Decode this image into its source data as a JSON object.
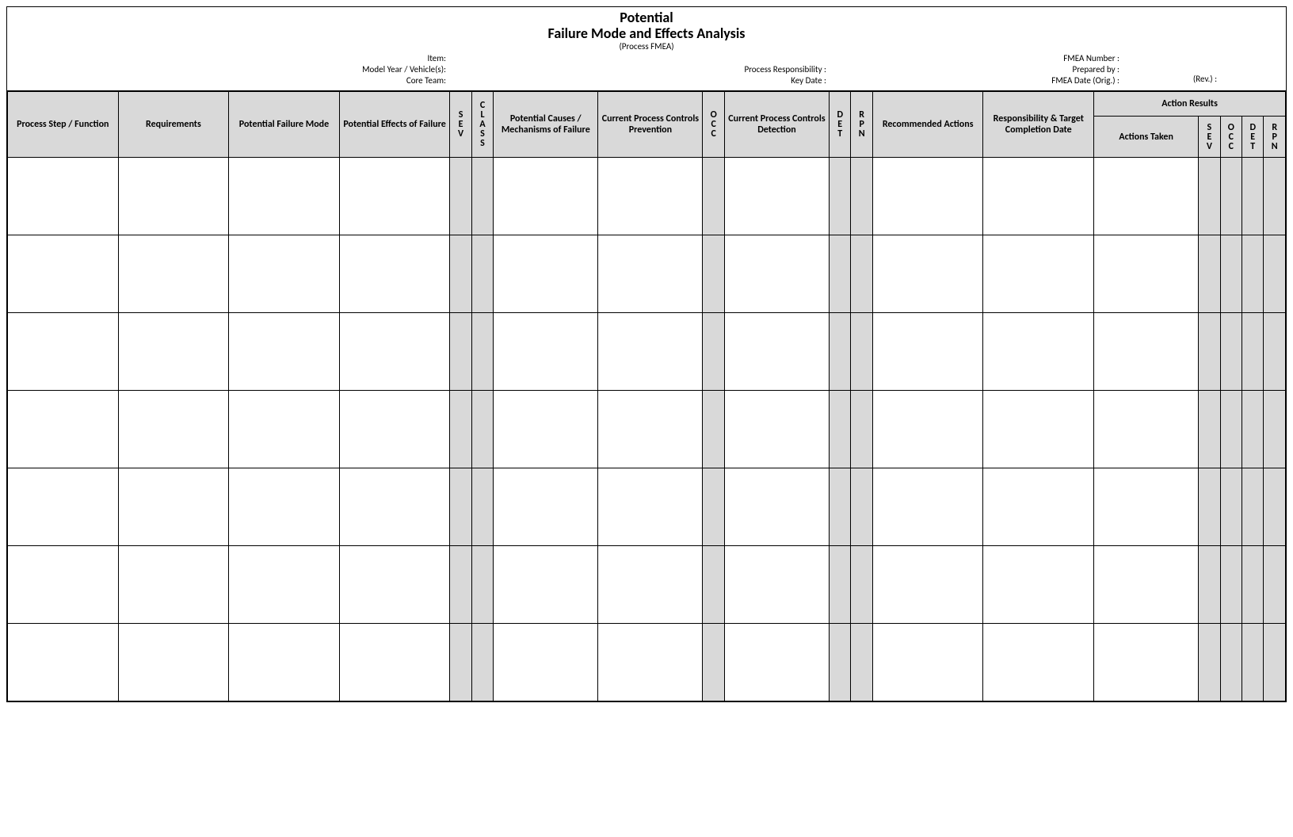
{
  "title": {
    "line1": "Potential",
    "line2": "Failure Mode and Effects Analysis",
    "line3": "(Process FMEA)"
  },
  "meta": {
    "item": "Item:",
    "model_year": "Model Year / Vehicle(s):",
    "core_team": "Core Team:",
    "process_resp": "Process Responsibility :",
    "key_date": "Key Date :",
    "fmea_number": "FMEA Number :",
    "prepared_by": "Prepared by :",
    "fmea_date": "FMEA Date (Orig.) :",
    "rev": "(Rev.) :"
  },
  "headers": {
    "process_step": "Process Step / Function",
    "requirements": "Requirements",
    "potential_failure_mode": "Potential Failure Mode",
    "potential_effects": "Potential Effects of Failure",
    "sev": "S\nE\nV",
    "class": "C\nL\nA\nS\nS",
    "potential_causes": "Potential Causes / Mechanisms of Failure",
    "controls_prevention": "Current Process Controls Prevention",
    "occ": "O\nC\nC",
    "controls_detection": "Current Process Controls Detection",
    "det": "D\nE\nT",
    "rpn": "R\nP\nN",
    "recommended_actions": "Recommended Actions",
    "responsibility_date": "Responsibility & Target Completion Date",
    "action_results": "Action Results",
    "actions_taken": "Actions Taken",
    "ar_sev": "S\nE\nV",
    "ar_occ": "O\nC\nC",
    "ar_det": "D\nE\nT",
    "ar_rpn": "R\nP\nN"
  }
}
